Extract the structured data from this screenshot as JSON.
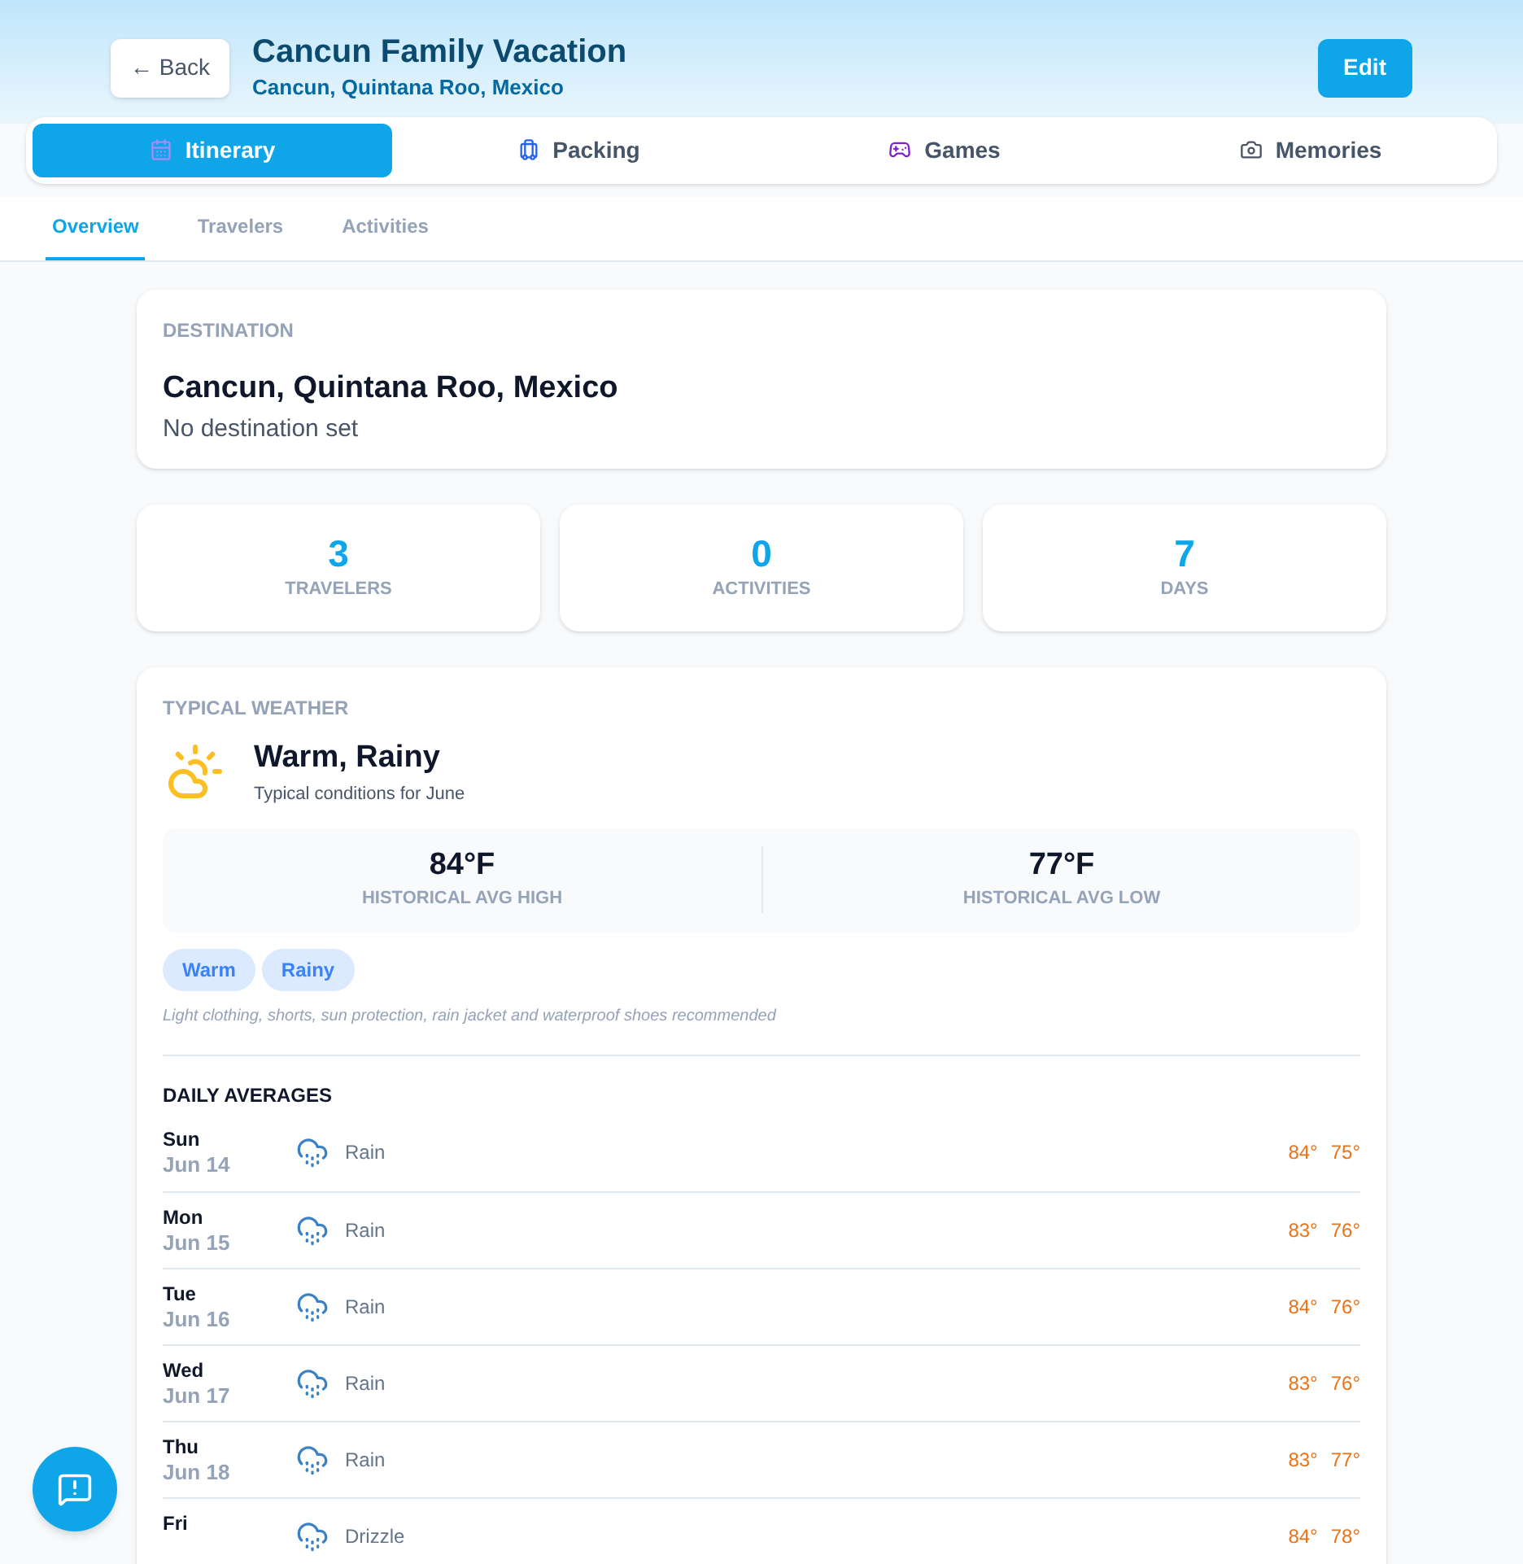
{
  "header": {
    "back": "← Back",
    "title": "Cancun Family Vacation",
    "subtitle": "Cancun, Quintana Roo, Mexico",
    "edit": "Edit"
  },
  "tabs": [
    {
      "label": "Itinerary",
      "selected": true
    },
    {
      "label": "Packing",
      "selected": false
    },
    {
      "label": "Games",
      "selected": false
    },
    {
      "label": "Memories",
      "selected": false
    }
  ],
  "subtabs": [
    {
      "label": "Overview",
      "selected": true
    },
    {
      "label": "Travelers",
      "selected": false
    },
    {
      "label": "Activities",
      "selected": false
    }
  ],
  "destination": {
    "heading": "DESTINATION",
    "name": "Cancun, Quintana Roo, Mexico",
    "note": "No destination set"
  },
  "stats": [
    {
      "value": "3",
      "label": "TRAVELERS"
    },
    {
      "value": "0",
      "label": "ACTIVITIES"
    },
    {
      "value": "7",
      "label": "DAYS"
    }
  ],
  "weather": {
    "heading": "TYPICAL WEATHER",
    "summary": "Warm, Rainy",
    "caption": "Typical conditions for June",
    "temps": [
      {
        "value": "84°F",
        "label": "HISTORICAL AVG HIGH"
      },
      {
        "value": "77°F",
        "label": "HISTORICAL AVG LOW"
      }
    ],
    "tags": [
      "Warm",
      "Rainy"
    ],
    "advice": "Light clothing, shorts, sun protection, rain jacket and waterproof shoes recommended",
    "daily_heading": "DAILY AVERAGES",
    "days": [
      {
        "day": "Sun",
        "date": "Jun 14",
        "condition": "Rain",
        "high": "84°",
        "low": "75°"
      },
      {
        "day": "Mon",
        "date": "Jun 15",
        "condition": "Rain",
        "high": "83°",
        "low": "76°"
      },
      {
        "day": "Tue",
        "date": "Jun 16",
        "condition": "Rain",
        "high": "84°",
        "low": "76°"
      },
      {
        "day": "Wed",
        "date": "Jun 17",
        "condition": "Rain",
        "high": "83°",
        "low": "76°"
      },
      {
        "day": "Thu",
        "date": "Jun 18",
        "condition": "Rain",
        "high": "83°",
        "low": "77°"
      },
      {
        "day": "Fri",
        "condition": "Drizzle",
        "high": "84°",
        "low": "78°"
      }
    ]
  }
}
